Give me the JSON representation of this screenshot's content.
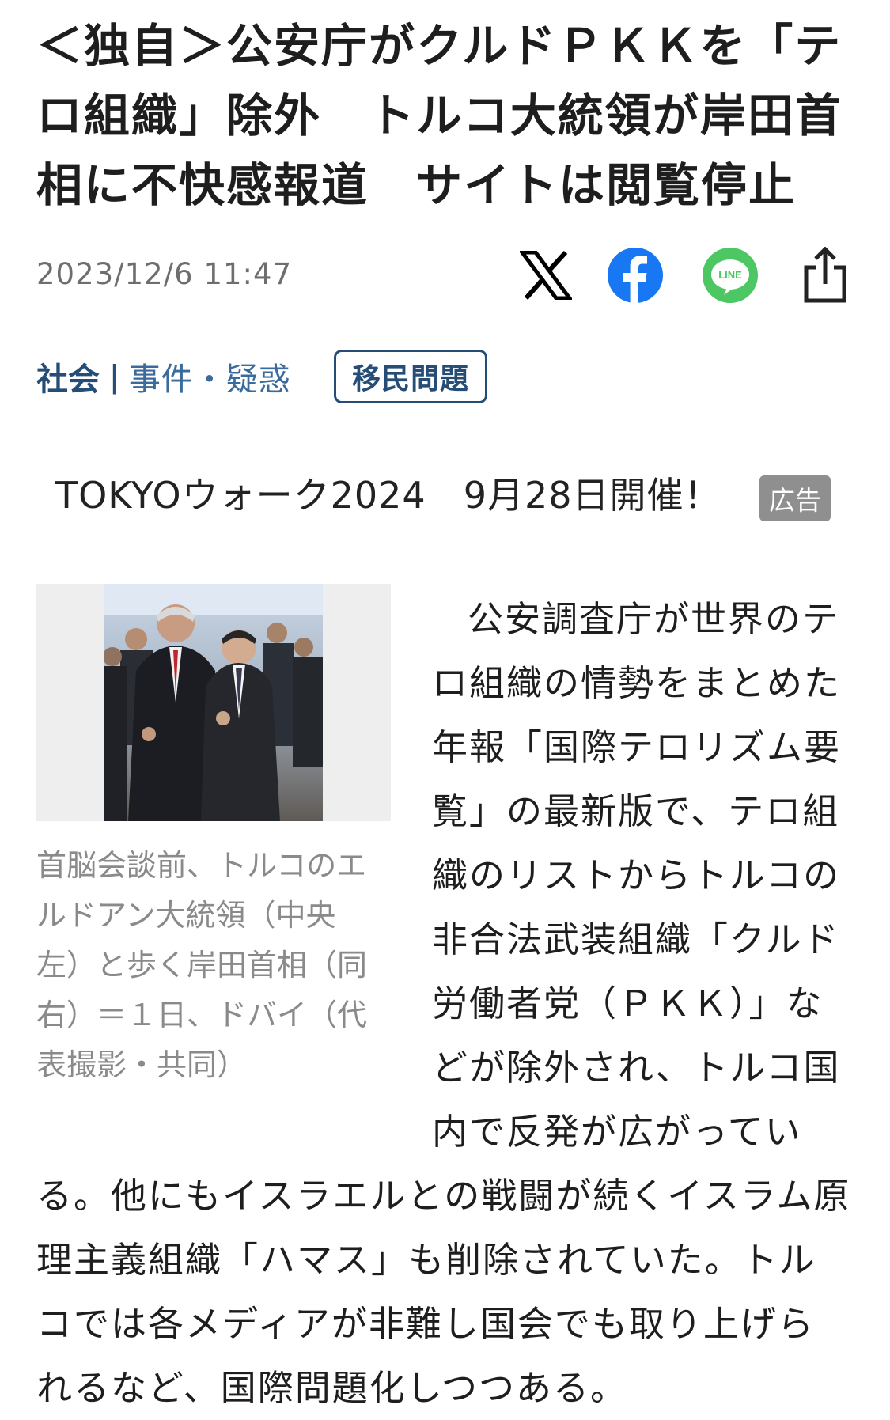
{
  "article": {
    "headline": "＜独自＞公安庁がクルドＰＫＫを「テロ組織」除外　トルコ大統領が岸田首相に不快感報道　サイトは閲覧停止",
    "timestamp": "2023/12/6 11:47"
  },
  "share": {
    "icons": [
      "x-icon",
      "facebook-icon",
      "line-icon",
      "share-icon"
    ],
    "line_label": "LINE",
    "colors": {
      "x": "#000000",
      "facebook": "#1877f2",
      "line": "#4cc764",
      "share": "#222222"
    }
  },
  "categories": {
    "main": "社会",
    "separator": "|",
    "sub": "事件・疑惑",
    "tag": "移民問題",
    "color": "#254d75"
  },
  "ad": {
    "text": "TOKYOウォーク2024　9月28日開催！",
    "badge": "広告"
  },
  "figure": {
    "caption": "首脳会談前、トルコのエルドアン大統領（中央左）と歩く岸田首相（同右）＝１日、ドバイ（代表撮影・共同）"
  },
  "body": {
    "paragraph": "公安調査庁が世界のテロ組織の情勢をまとめた年報「国際テロリズム要覧」の最新版で、テロ組織のリストからトルコの非合法武装組織「クルド労働者党（ＰＫＫ）」などが除外され、トルコ国内で反発が広がっている。他にもイスラエルとの戦闘が続くイスラム原理主義組織「ハマス」も削除されていた。トルコでは各メディアが非難し国会でも取り上げられるなど、国際問題化しつつある。"
  }
}
